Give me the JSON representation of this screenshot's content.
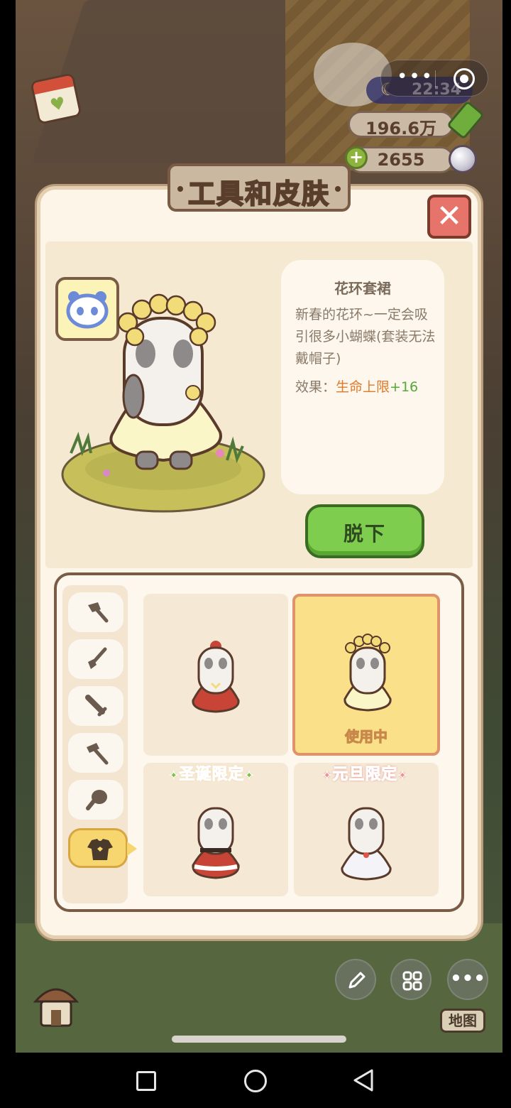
{
  "status": {
    "time": "22:34",
    "bamboo_count": "196.6万",
    "pearl_count": "2655"
  },
  "dialog": {
    "title": "工具和皮肤",
    "item": {
      "name": "花环套裙",
      "description": "新春的花环~一定会吸引很多小蝴蝶(套装无法戴帽子)",
      "effect_label": "效果：",
      "effect_stat": "生命上限",
      "effect_bonus": "+16"
    },
    "unequip_label": "脱下",
    "categories": [
      {
        "name": "axe",
        "icon": "axe-icon"
      },
      {
        "name": "shovel",
        "icon": "shovel-icon"
      },
      {
        "name": "sword",
        "icon": "sword-icon"
      },
      {
        "name": "hammer",
        "icon": "hammer-icon"
      },
      {
        "name": "meat",
        "icon": "meat-icon"
      },
      {
        "name": "clothing",
        "icon": "shirt-icon",
        "active": true
      }
    ],
    "skins": [
      {
        "name": "red-dress",
        "tag": "",
        "in_use": false
      },
      {
        "name": "flower-dress",
        "tag": "",
        "in_use": true,
        "in_use_label": "使用中"
      },
      {
        "name": "santa-suit",
        "tag": "圣诞限定",
        "in_use": false
      },
      {
        "name": "white-cape",
        "tag": "元旦限定",
        "in_use": false
      }
    ]
  },
  "bottom": {
    "map_label": "地图"
  },
  "colors": {
    "accent_green": "#7fcd4e",
    "close_red": "#e7746a",
    "in_use_yellow": "#fbe08a"
  }
}
